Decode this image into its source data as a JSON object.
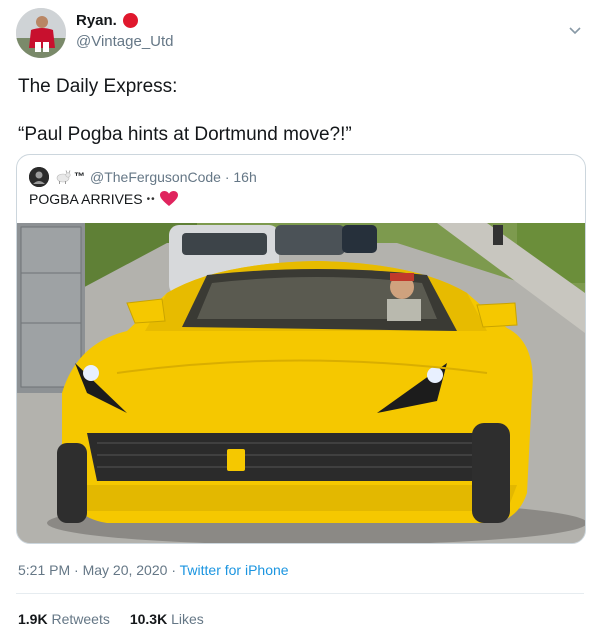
{
  "author": {
    "display_name": "Ryan.",
    "handle": "@Vintage_Utd",
    "badge_color": "#e0182d"
  },
  "tweet": {
    "line1": "The Daily Express:",
    "line2": "“Paul Pogba hints at Dortmund move?!”"
  },
  "quoted": {
    "handle_and_time": "@TheFergusonCode · 16h",
    "name_suffix": "™",
    "text": "POGBA ARRIVES",
    "eyes": "••",
    "heart_color": "#e0245e"
  },
  "meta": {
    "time": "5:21 PM · May 20, 2020",
    "separator": "·",
    "source": "Twitter for iPhone"
  },
  "stats": {
    "retweets_count": "1.9K",
    "retweets_label": "Retweets",
    "likes_count": "10.3K",
    "likes_label": "Likes"
  },
  "colors": {
    "accent": "#1b95e0",
    "muted": "#657786",
    "text": "#14171a",
    "car_yellow": "#f5c800"
  },
  "icons": {
    "caret": "chevron-down-icon",
    "heart": "heart-icon",
    "goat": "goat-icon"
  }
}
